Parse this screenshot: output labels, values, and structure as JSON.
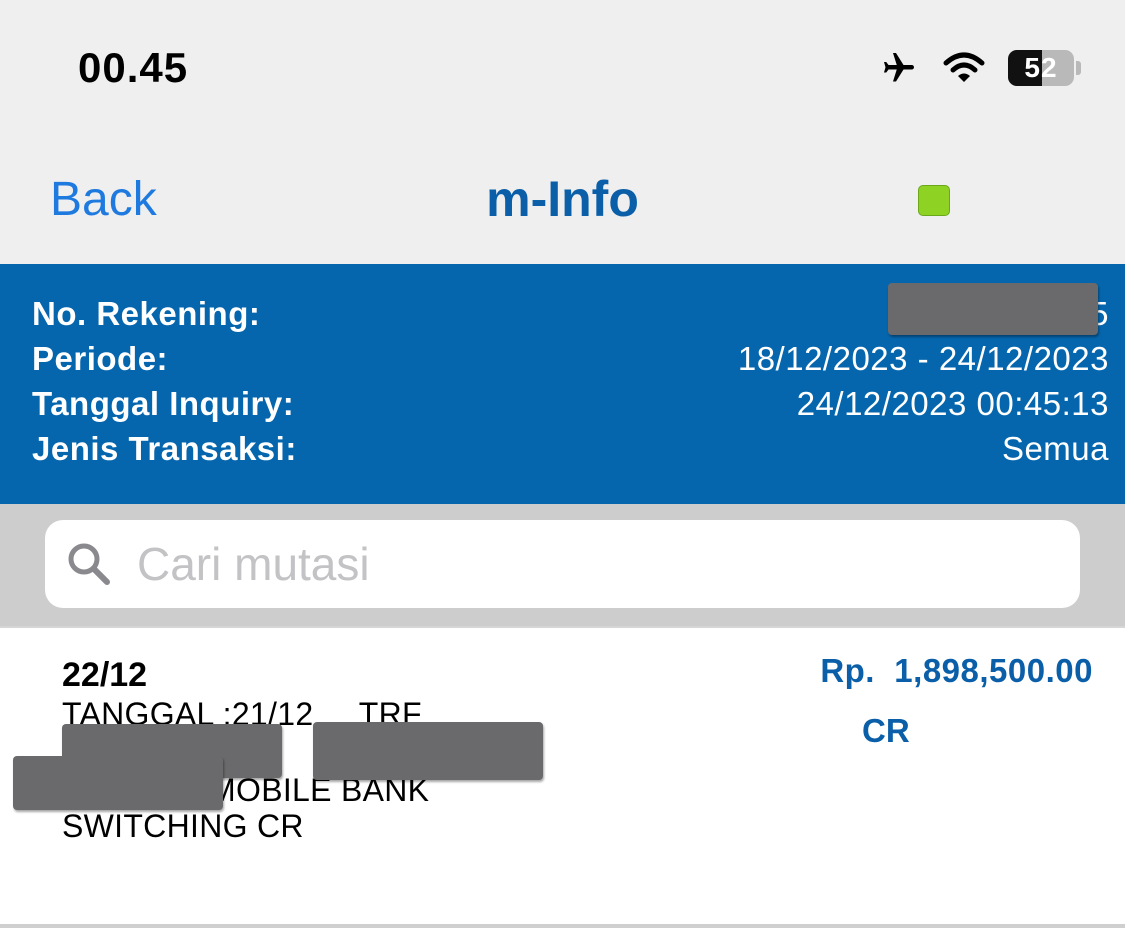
{
  "status_bar": {
    "time": "00.45",
    "battery_level": "52",
    "battery_fraction": 0.52,
    "icons": [
      "airplane-icon",
      "wifi-icon",
      "battery-icon"
    ]
  },
  "nav": {
    "back_label": "Back",
    "title": "m-Info",
    "indicator_color": "#8ed324"
  },
  "account_info": {
    "rows": [
      {
        "label": "No. Rekening:",
        "value": "6             5"
      },
      {
        "label": "Periode:",
        "value": "18/12/2023 - 24/12/2023"
      },
      {
        "label": "Tanggal Inquiry:",
        "value": "24/12/2023 00:45:13"
      },
      {
        "label": "Jenis Transaksi:",
        "value": "Semua"
      }
    ]
  },
  "search": {
    "placeholder": "Cari mutasi",
    "value": ""
  },
  "transactions": [
    {
      "date": "22/12",
      "description_lines": [
        "TANGGAL :21/12     TRF",
        "                   U                 R",
        "                MOBILE BANK",
        "SWITCHING CR"
      ],
      "amount": "Rp.  1,898,500.00",
      "type": "CR"
    }
  ],
  "colors": {
    "header_blue": "#0566ad",
    "link_blue": "#1f7ae0",
    "amount_blue": "#0a5fa8",
    "redaction_gray": "#6a6a6c"
  }
}
